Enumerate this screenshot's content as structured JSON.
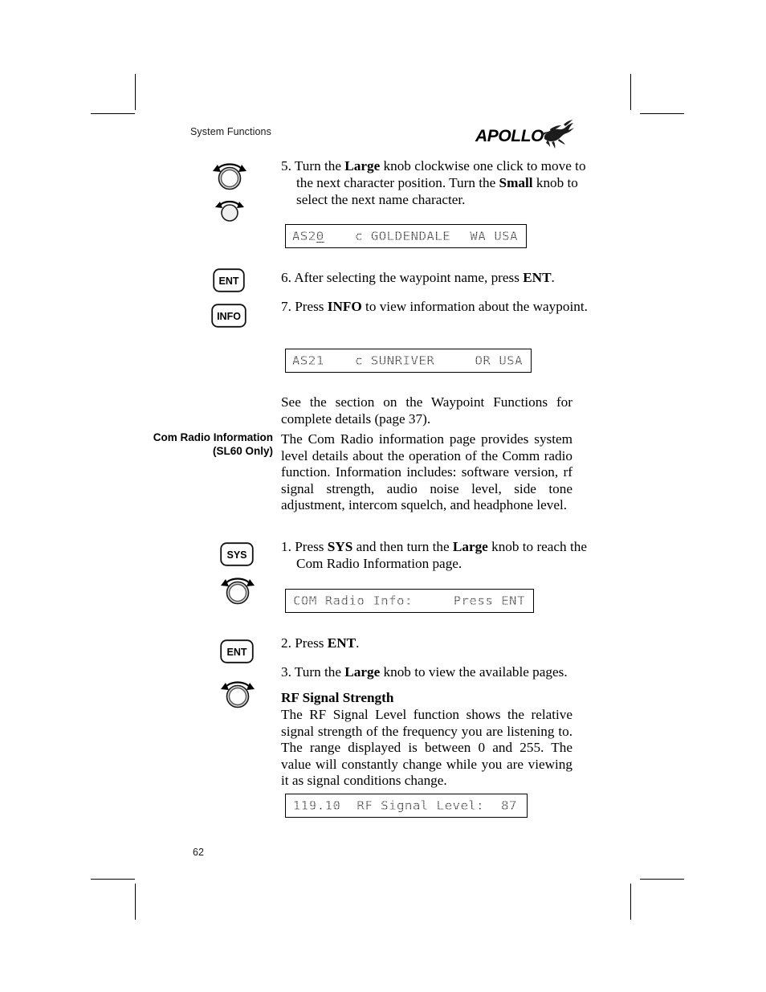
{
  "document": {
    "header_title": "System Functions",
    "brand": "APOLLO",
    "brand_icon": "pegasus-logo",
    "page_number": "62"
  },
  "steps": {
    "step5_num": "5.",
    "step5_a": "Turn the ",
    "step5_large": "Large",
    "step5_b": " knob clockwise one click to move to the next character position. Turn the ",
    "step5_small": "Small",
    "step5_c": " knob to select the next name character.",
    "step6_num": "6.",
    "step6_a": "After selecting the waypoint name, press ",
    "step6_ent": "ENT",
    "step6_b": ".",
    "step7_num": "7.",
    "step7_a": "Press ",
    "step7_info": "INFO",
    "step7_b": " to view information about the waypoint.",
    "step1_num": "1.",
    "step1_a": "Press ",
    "step1_sys": "SYS",
    "step1_b": " and then turn the ",
    "step1_large": "Large",
    "step1_c": " knob to reach the Com Radio Information page.",
    "step2_num": "2.",
    "step2_a": "Press ",
    "step2_ent": "ENT",
    "step2_b": ".",
    "step3_num": "3.",
    "step3_a": "Turn the ",
    "step3_large": "Large",
    "step3_b": " knob to view the available pages."
  },
  "body": {
    "see_section": "See the section on the Waypoint Functions for complete details (page 37).",
    "com_radio_heading": "Com Radio Information (SL60 Only)",
    "com_radio_paragraph": "The Com Radio information page provides system level details about the operation of the Comm radio function. Information includes: software version, rf signal strength, audio noise level, side tone adjustment, intercom squelch, and headphone level.",
    "rf_heading": "RF Signal Strength",
    "rf_paragraph": "The RF Signal Level function shows the relative signal strength of the frequency you are listening to. The range displayed is between 0 and 255. The value will constantly change while you are viewing it as signal conditions change."
  },
  "lcd_screens": [
    {
      "id": "waypoint-name-entry",
      "left": "AS2",
      "cursor": "0",
      "mid": "c GOLDENDALE",
      "right": "WA USA"
    },
    {
      "id": "waypoint-info",
      "left": "AS21",
      "mid": "c SUNRIVER",
      "right": "OR USA"
    },
    {
      "id": "com-radio-info-prompt",
      "left": "COM Radio Info:",
      "right": "Press ENT"
    },
    {
      "id": "rf-signal-level",
      "left": "119.10  RF Signal Level:",
      "right": "87"
    }
  ],
  "buttons": {
    "ent": "ENT",
    "info": "INFO",
    "sys": "SYS"
  },
  "icons": {
    "large_knob": "large-knob-icon",
    "small_knob": "small-knob-icon"
  }
}
